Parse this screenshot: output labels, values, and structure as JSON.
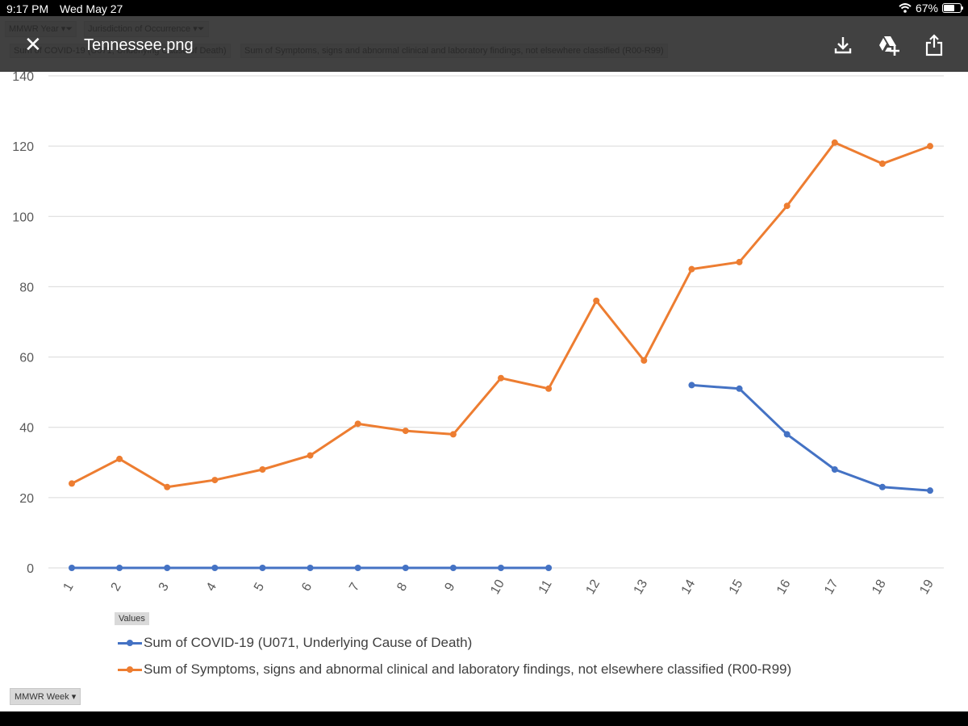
{
  "status_bar": {
    "time": "9:17 PM",
    "date": "Wed May 27",
    "battery": "67%",
    "battery_level": 0.67,
    "wifi_icon": "wifi-icon"
  },
  "viewer": {
    "title": "Tennessee.png",
    "close_icon": "close-icon",
    "actions": [
      {
        "name": "download",
        "icon": "download-icon"
      },
      {
        "name": "save-to-drive",
        "icon": "drive-add-icon"
      },
      {
        "name": "share",
        "icon": "share-icon"
      }
    ]
  },
  "pivot": {
    "filters": [
      "MMWR Year",
      "Jurisdiction of Occurrence"
    ],
    "value_fields": [
      "Sum of COVID-19 (U071, Underlying Cause of Death)",
      "Sum of Symptoms, signs and abnormal clinical and laboratory findings, not elsewhere classified (R00-R99)"
    ],
    "legend_header": "Values",
    "axis_field": "MMWR Week"
  },
  "chart_data": {
    "type": "line",
    "title": "",
    "xlabel": "",
    "ylabel": "",
    "x": [
      1,
      2,
      3,
      4,
      5,
      6,
      7,
      8,
      9,
      10,
      11,
      12,
      13,
      14,
      15,
      16,
      17,
      18,
      19
    ],
    "categories": [
      "1",
      "2",
      "3",
      "4",
      "5",
      "6",
      "7",
      "8",
      "9",
      "10",
      "11",
      "12",
      "13",
      "14",
      "15",
      "16",
      "17",
      "18",
      "19"
    ],
    "ylim": [
      0,
      140
    ],
    "yticks": [
      0,
      20,
      40,
      60,
      80,
      100,
      120,
      140
    ],
    "grid": true,
    "legend_position": "bottom",
    "series": [
      {
        "name": "Sum of COVID-19 (U071, Underlying Cause of Death)",
        "color": "#4472c4",
        "values": [
          0,
          0,
          0,
          0,
          0,
          0,
          0,
          0,
          0,
          0,
          0,
          null,
          null,
          52,
          51,
          38,
          28,
          23,
          22
        ]
      },
      {
        "name": "Sum of Symptoms, signs and abnormal clinical and laboratory findings, not elsewhere classified (R00-R99)",
        "color": "#ed7d31",
        "values": [
          24,
          31,
          23,
          25,
          28,
          32,
          41,
          39,
          38,
          54,
          51,
          76,
          59,
          85,
          87,
          103,
          121,
          115,
          120
        ]
      }
    ]
  }
}
